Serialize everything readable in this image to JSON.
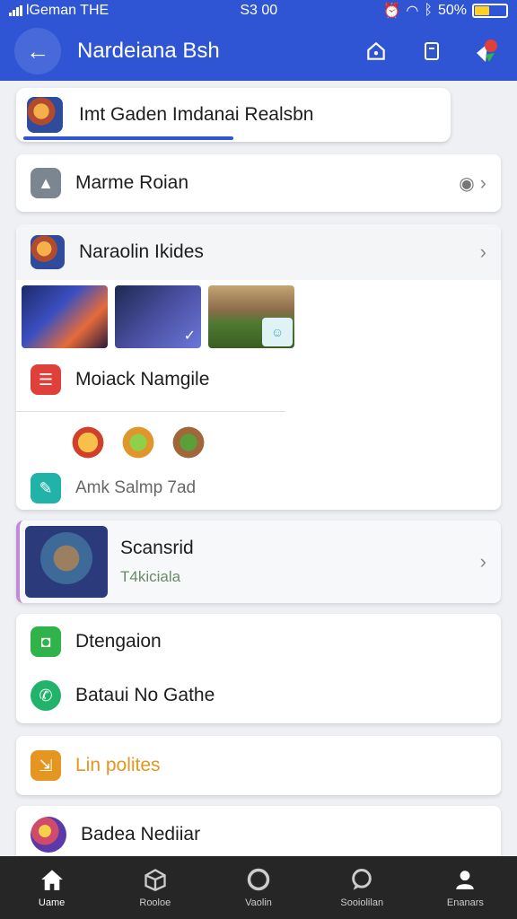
{
  "status": {
    "carrier": "lGeman THE",
    "time": "S3 00",
    "battery": "50%",
    "battery_level": 0.5
  },
  "header": {
    "title": "Nardeiana Bsh"
  },
  "search": {
    "text": "Imt Gaden Imdanai  Realsbn",
    "progress": 0.5
  },
  "items": {
    "marme": "Marme Roian",
    "naraolin": "Naraolin Ikides",
    "moiack": "Moiack Namgile",
    "amk": "Amk  Salmp 7ad",
    "scanerid_title": "Scansrid",
    "scanerid_sub": "T4kiciala",
    "dtengaion": "Dtengaion",
    "bataui": "Bataui No Gathe",
    "lin": "Lin polites",
    "badea": "Badea Nediiar"
  },
  "nav": [
    {
      "label": "Uame"
    },
    {
      "label": "Rooloe"
    },
    {
      "label": "Vaolin"
    },
    {
      "label": "Sooiolilan"
    },
    {
      "label": "Enanars"
    }
  ],
  "colors": {
    "primary": "#2f55d4",
    "orange": "#e59620",
    "green": "#2fb34a",
    "teal": "#22b3a8",
    "red": "#e0403a"
  }
}
